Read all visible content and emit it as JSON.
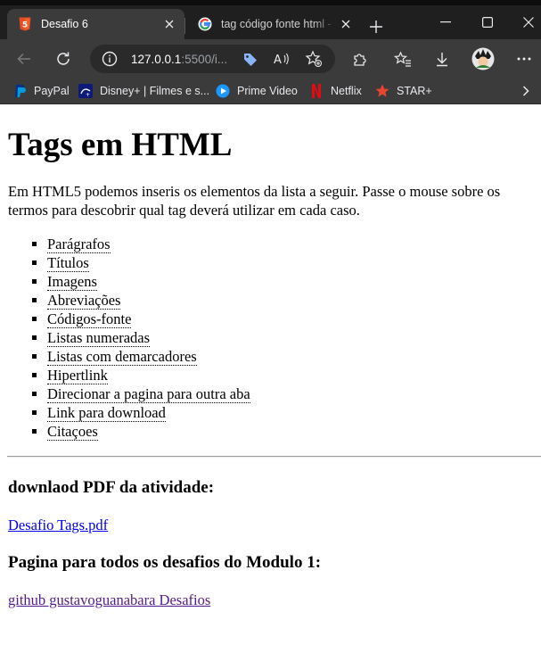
{
  "browser": {
    "tabs": [
      {
        "title": "Desafio 6",
        "active": true,
        "favicon": "html5-icon"
      },
      {
        "title": "tag código fonte html - Pesquisar",
        "active": false,
        "favicon": "google-icon"
      }
    ],
    "url_host": "127.0.0.1",
    "url_path": ":5500/i...",
    "favorites": [
      {
        "label": "PayPal",
        "icon": "paypal-icon"
      },
      {
        "label": "Disney+ | Filmes e s...",
        "icon": "disney-icon"
      },
      {
        "label": "Prime Video",
        "icon": "prime-video-icon"
      },
      {
        "label": "Netflix",
        "icon": "netflix-icon"
      },
      {
        "label": "STAR+",
        "icon": "star-plus-icon"
      }
    ],
    "colors": {
      "tabbar": "#1f1f1f",
      "active_tab": "#3b3b3b",
      "html5": "#e44d26",
      "netflix": "#e50914"
    }
  },
  "page": {
    "title": "Tags em HTML",
    "intro": "Em HTML5 podemos inseris os elementos da lista a seguir. Passe o mouse sobre os termos para descobrir qual tag deverá utilizar em cada caso.",
    "items": [
      "Parágrafos",
      "Títulos",
      "Imagens",
      "Abreviações",
      "Códigos-fonte",
      "Listas numeradas",
      "Listas com demarcadores",
      "Hipertlink",
      "Direcionar a pagina para outra aba",
      "Link para download",
      "Citaçoes"
    ],
    "download_heading": "downlaod PDF da atividade:",
    "download_link": "Desafio Tags.pdf",
    "challenges_heading": "Pagina para todos os desafios do Modulo 1:",
    "challenges_link": "github gustavoguanabara Desafios"
  }
}
